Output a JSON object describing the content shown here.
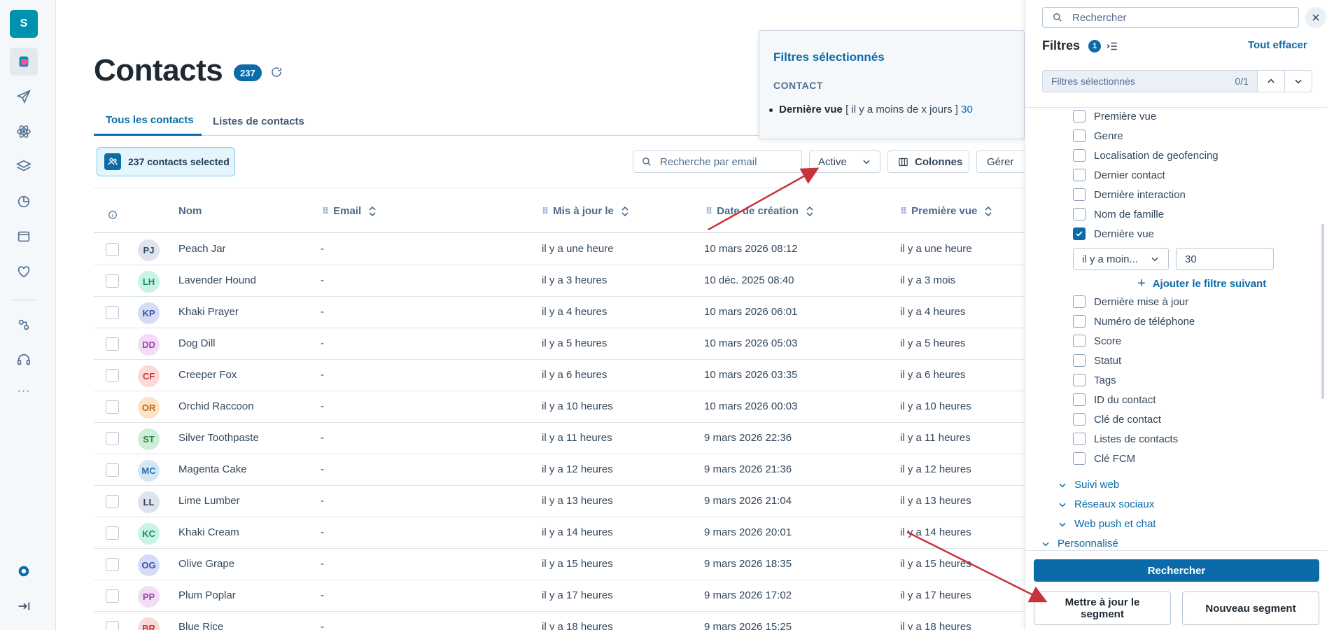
{
  "nav": {
    "logo": "S"
  },
  "header": {
    "title": "Contacts",
    "count": "237"
  },
  "tabs": [
    {
      "label": "Tous les contacts"
    },
    {
      "label": "Listes de contacts"
    }
  ],
  "toolbar": {
    "selected_label": "237 contacts selected",
    "email_placeholder": "Recherche par email",
    "status_value": "Active",
    "columns_label": "Colonnes",
    "manage_label": "Gérer"
  },
  "table": {
    "columns": {
      "name": "Nom",
      "email": "Email",
      "updated": "Mis à jour le",
      "created": "Date de création",
      "first_seen": "Première vue"
    },
    "rows": [
      {
        "initials": "PJ",
        "name": "Peach Jar",
        "email": "-",
        "updated": "il y a une heure",
        "created": "10 mars 2026 08:12",
        "first_seen": "il y a une heure",
        "bg": "#dfe3eb",
        "fg": "#33475b"
      },
      {
        "initials": "LH",
        "name": "Lavender Hound",
        "email": "-",
        "updated": "il y a 3 heures",
        "created": "10 déc. 2025 08:40",
        "first_seen": "il y a 3 mois",
        "bg": "#c8f4e4",
        "fg": "#1a8a62"
      },
      {
        "initials": "KP",
        "name": "Khaki Prayer",
        "email": "-",
        "updated": "il y a 4 heures",
        "created": "10 mars 2026 06:01",
        "first_seen": "il y a 4 heures",
        "bg": "#d6dcf7",
        "fg": "#3d4ea8"
      },
      {
        "initials": "DD",
        "name": "Dog Dill",
        "email": "-",
        "updated": "il y a 5 heures",
        "created": "10 mars 2026 05:03",
        "first_seen": "il y a 5 heures",
        "bg": "#f3dcf5",
        "fg": "#a046ae"
      },
      {
        "initials": "CF",
        "name": "Creeper Fox",
        "email": "-",
        "updated": "il y a 6 heures",
        "created": "10 mars 2026 03:35",
        "first_seen": "il y a 6 heures",
        "bg": "#fbd9d9",
        "fg": "#c23b3b"
      },
      {
        "initials": "OR",
        "name": "Orchid Raccoon",
        "email": "-",
        "updated": "il y a 10 heures",
        "created": "10 mars 2026 00:03",
        "first_seen": "il y a 10 heures",
        "bg": "#fde3c6",
        "fg": "#c26a0f"
      },
      {
        "initials": "ST",
        "name": "Silver Toothpaste",
        "email": "-",
        "updated": "il y a 11 heures",
        "created": "9 mars 2026 22:36",
        "first_seen": "il y a 11 heures",
        "bg": "#cdeed7",
        "fg": "#2a8a49"
      },
      {
        "initials": "MC",
        "name": "Magenta Cake",
        "email": "-",
        "updated": "il y a 12 heures",
        "created": "9 mars 2026 21:36",
        "first_seen": "il y a 12 heures",
        "bg": "#d2e8f7",
        "fg": "#2a6fa8"
      },
      {
        "initials": "LL",
        "name": "Lime Lumber",
        "email": "-",
        "updated": "il y a 13 heures",
        "created": "9 mars 2026 21:04",
        "first_seen": "il y a 13 heures",
        "bg": "#dfe3eb",
        "fg": "#33475b"
      },
      {
        "initials": "KC",
        "name": "Khaki Cream",
        "email": "-",
        "updated": "il y a 14 heures",
        "created": "9 mars 2026 20:01",
        "first_seen": "il y a 14 heures",
        "bg": "#c8f4e4",
        "fg": "#1a8a62"
      },
      {
        "initials": "OG",
        "name": "Olive Grape",
        "email": "-",
        "updated": "il y a 15 heures",
        "created": "9 mars 2026 18:35",
        "first_seen": "il y a 15 heures",
        "bg": "#d6dcf7",
        "fg": "#3d4ea8"
      },
      {
        "initials": "PP",
        "name": "Plum Poplar",
        "email": "-",
        "updated": "il y a 17 heures",
        "created": "9 mars 2026 17:02",
        "first_seen": "il y a 17 heures",
        "bg": "#f3dcf5",
        "fg": "#a046ae"
      },
      {
        "initials": "BR",
        "name": "Blue Rice",
        "email": "-",
        "updated": "il y a 18 heures",
        "created": "9 mars 2026 15:25",
        "first_seen": "il y a 18 heures",
        "bg": "#fbd9d9",
        "fg": "#c23b3b"
      }
    ]
  },
  "filter_popover": {
    "title": "Filtres sélectionnés",
    "section": "CONTACT",
    "field": "Dernière vue",
    "condition": "[ il y a moins de x jours ]",
    "value": "30"
  },
  "panel": {
    "search_placeholder": "Rechercher",
    "filters_title": "Filtres",
    "filters_count": "1",
    "clear_all": "Tout effacer",
    "selected_filters_label": "Filtres sélectionnés",
    "selected_filters_pos": "0/1",
    "fields_before": [
      "Première vue",
      "Genre",
      "Localisation de geofencing",
      "Dernier contact",
      "Dernière interaction",
      "Nom de famille"
    ],
    "checked_field": "Dernière vue",
    "operator_value": "il y a moin...",
    "input_value": "30",
    "add_next_filter": "Ajouter le filtre suivant",
    "fields_after": [
      "Dernière mise à jour",
      "Numéro de téléphone",
      "Score",
      "Statut",
      "Tags",
      "ID du contact",
      "Clé de contact",
      "Listes de contacts",
      "Clé FCM"
    ],
    "groups": [
      "Suivi web",
      "Réseaux sociaux",
      "Web push et chat"
    ],
    "custom_group": "Personnalisé",
    "search_button": "Rechercher",
    "update_segment_button": "Mettre à jour le segment",
    "new_segment_button": "Nouveau segment"
  },
  "colors": {
    "primary": "#0b6ba8",
    "arrow": "#c8323c"
  }
}
